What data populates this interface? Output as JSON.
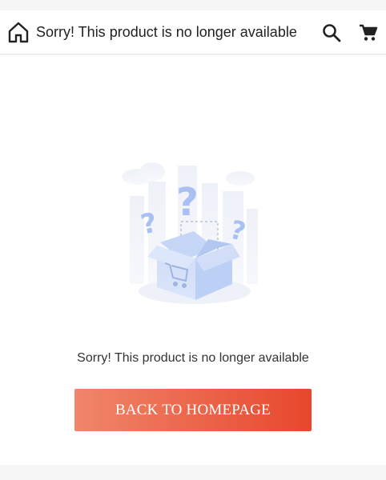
{
  "header": {
    "title": "Sorry! This product is no longer available",
    "home_icon": "home-icon",
    "search_icon": "search-icon",
    "cart_icon": "cart-icon"
  },
  "main": {
    "message": "Sorry! This product is no longer available",
    "back_button_label": "BACK TO HOMEPAGE",
    "illustration": "empty-box-question-marks"
  },
  "colors": {
    "button_gradient_start": "#f0866a",
    "button_gradient_end": "#e8472d",
    "illustration_blue": "#a9c1f2"
  }
}
